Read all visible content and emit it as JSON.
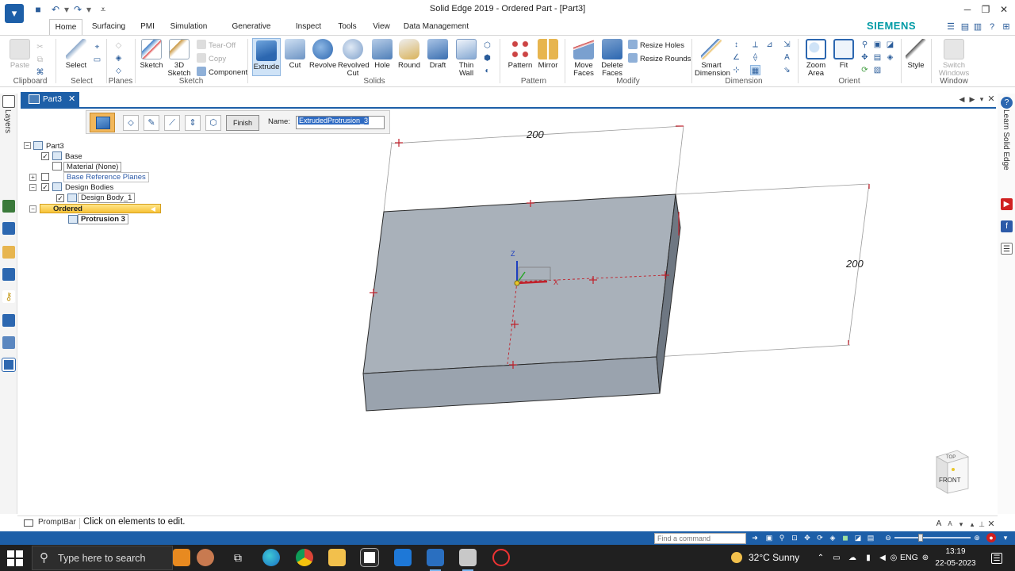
{
  "window": {
    "title": "Solid Edge 2019 - Ordered Part - [Part3]",
    "brand": "SIEMENS"
  },
  "menu_tabs": [
    {
      "label": "Home",
      "active": true
    },
    {
      "label": "Surfacing"
    },
    {
      "label": "PMI"
    },
    {
      "label": "Simulation"
    },
    {
      "label": "Generative Design"
    },
    {
      "label": "Inspect"
    },
    {
      "label": "Tools"
    },
    {
      "label": "View"
    },
    {
      "label": "Data Management"
    }
  ],
  "ribbon": {
    "clipboard": {
      "paste": "Paste",
      "group": "Clipboard"
    },
    "select": {
      "select": "Select",
      "group": "Select"
    },
    "planes": {
      "group": "Planes"
    },
    "sketch": {
      "sketch": "Sketch",
      "sketch3d_line1": "3D",
      "sketch3d_line2": "Sketch",
      "tear_off": "Tear-Off",
      "copy": "Copy",
      "component": "Component",
      "group": "Sketch"
    },
    "solids": {
      "extrude": "Extrude",
      "cut": "Cut",
      "revolve": "Revolve",
      "revolved_cut_line1": "Revolved",
      "revolved_cut_line2": "Cut",
      "hole": "Hole",
      "round": "Round",
      "draft": "Draft",
      "thin_wall_line1": "Thin",
      "thin_wall_line2": "Wall",
      "group": "Solids"
    },
    "pattern": {
      "pattern": "Pattern",
      "mirror": "Mirror",
      "group": "Pattern"
    },
    "modify": {
      "move_faces_line1": "Move",
      "move_faces_line2": "Faces",
      "delete_faces_line1": "Delete",
      "delete_faces_line2": "Faces",
      "resize_holes": "Resize Holes",
      "resize_rounds": "Resize Rounds",
      "group": "Modify"
    },
    "dimension": {
      "smart_line1": "Smart",
      "smart_line2": "Dimension",
      "group": "Dimension"
    },
    "orient": {
      "zoom_area_line1": "Zoom",
      "zoom_area_line2": "Area",
      "fit": "Fit",
      "group": "Orient"
    },
    "style": {
      "style": "Style"
    },
    "window": {
      "switch_line1": "Switch",
      "switch_line2": "Windows",
      "group": "Window"
    }
  },
  "document_tab": {
    "label": "Part3"
  },
  "left_panel": {
    "label": "Layers"
  },
  "right_panel": {
    "label": "Learn Solid Edge"
  },
  "command_bar": {
    "finish": "Finish",
    "name_label": "Name:",
    "name_value": "ExtrudedProtrusion_3"
  },
  "tree": {
    "root": "Part3",
    "base": "Base",
    "material": "Material (None)",
    "base_ref_planes": "Base Reference Planes",
    "design_bodies": "Design Bodies",
    "design_body_1": "Design Body_1",
    "ordered": "Ordered",
    "protrusion": "Protrusion 3"
  },
  "model": {
    "dim_width": "200",
    "dim_depth": "200",
    "axis_z": "Z",
    "axis_x": "X"
  },
  "viewcube": {
    "top": "TOP",
    "front": "FRONT"
  },
  "prompt": {
    "title": "PromptBar",
    "text": "Click on elements to edit."
  },
  "statusbar": {
    "find_placeholder": "Find a command"
  },
  "taskbar": {
    "search_placeholder": "Type here to search",
    "weather": "32°C  Sunny",
    "lang": "ENG",
    "time": "13:19",
    "date": "22-05-2023"
  },
  "colors": {
    "accent_blue": "#1d5fa8",
    "brand_teal": "#009aa5",
    "highlight_yellow": "#f8c236",
    "dimension_red": "#c0202a"
  }
}
